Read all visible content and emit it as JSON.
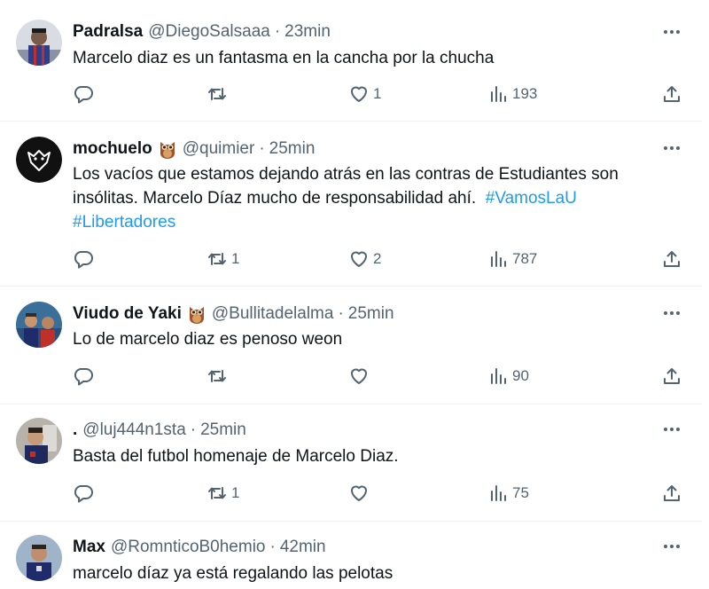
{
  "colors": {
    "text": "#0f1419",
    "secondary": "#536471",
    "hashtag": "#1d9bf0",
    "divider": "#eff3f4"
  },
  "icons": {
    "reply": "reply-icon",
    "retweet": "retweet-icon",
    "like": "heart-icon",
    "views": "views-icon",
    "share": "share-icon",
    "more": "more-icon"
  },
  "tweets": [
    {
      "name": "Padralsa",
      "handle": "@DiegoSalsaaa",
      "separator": "·",
      "time": "23min",
      "text": "Marcelo diaz es un fantasma en la cancha por la chucha",
      "replies": "",
      "retweets": "",
      "likes": "1",
      "views": "193"
    },
    {
      "name": "mochuelo",
      "handle": "@quimier",
      "separator": "·",
      "time": "25min",
      "text": "Los vacíos que estamos dejando atrás en las contras de Estudiantes son insólitas. Marcelo Díaz mucho de responsabilidad ahí.",
      "hashtag1": "#VamosLaU",
      "hashtag2": "#Libertadores",
      "replies": "",
      "retweets": "1",
      "likes": "2",
      "views": "787"
    },
    {
      "name": "Viudo de Yaki",
      "handle": "@Bullitadelalma",
      "separator": "·",
      "time": "25min",
      "text": "Lo de marcelo diaz es penoso weon",
      "replies": "",
      "retweets": "",
      "likes": "",
      "views": "90"
    },
    {
      "name": ".",
      "handle": "@luj444n1sta",
      "separator": "·",
      "time": "25min",
      "text": "Basta del futbol homenaje de Marcelo Diaz.",
      "replies": "",
      "retweets": "1",
      "likes": "",
      "views": "75"
    },
    {
      "name": "Max",
      "handle": "@RomnticoB0hemio",
      "separator": "·",
      "time": "42min",
      "text": "marcelo díaz ya está regalando las pelotas"
    }
  ]
}
